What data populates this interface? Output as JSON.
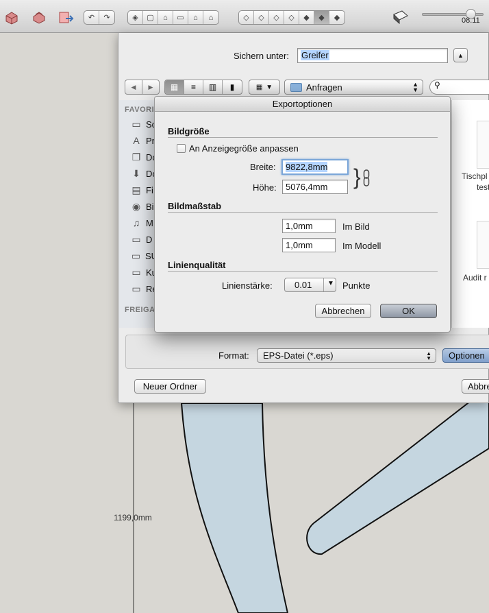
{
  "toolbar": {
    "zoom_value": "08.11"
  },
  "canvas": {
    "dimension_label": "1199,0mm"
  },
  "save_sheet": {
    "save_as_label": "Sichern unter:",
    "save_as_value": "Greifer",
    "location": "Anfragen",
    "search_placeholder": "",
    "sidebar": {
      "favorites_header": "FAVORI",
      "shared_header": "FREIGA",
      "items": [
        "Sc",
        "Pr",
        "Do",
        "Do",
        "Fi",
        "Bi",
        "M",
        "D",
        "SU",
        "Ku",
        "Re"
      ]
    },
    "files": [
      {
        "name": "Tischpl"
      },
      {
        "name": "test"
      },
      {
        "name": "Audit r"
      }
    ],
    "format_label": "Format:",
    "format_value": "EPS-Datei (*.eps)",
    "options_button": "Optionen",
    "new_folder_button": "Neuer Ordner",
    "cancel_button": "Abbre"
  },
  "export_dialog": {
    "title": "Exportoptionen",
    "image_size": {
      "header": "Bildgröße",
      "fit_to_view_label": "An Anzeigegröße anpassen",
      "fit_to_view_checked": false,
      "width_label": "Breite:",
      "width_value": "9822,8mm",
      "height_label": "Höhe:",
      "height_value": "5076,4mm"
    },
    "image_scale": {
      "header": "Bildmaßstab",
      "in_image_value": "1,0mm",
      "in_image_label": "Im Bild",
      "in_model_value": "1,0mm",
      "in_model_label": "Im Modell"
    },
    "line_quality": {
      "header": "Linienqualität",
      "line_width_label": "Linienstärke:",
      "line_width_value": "0.01",
      "unit_label": "Punkte"
    },
    "cancel_button": "Abbrechen",
    "ok_button": "OK"
  },
  "colors": {
    "shape_fill": "#c5d6e0",
    "canvas_bg": "#d9d7d2",
    "selection": "#b5d5ff"
  }
}
